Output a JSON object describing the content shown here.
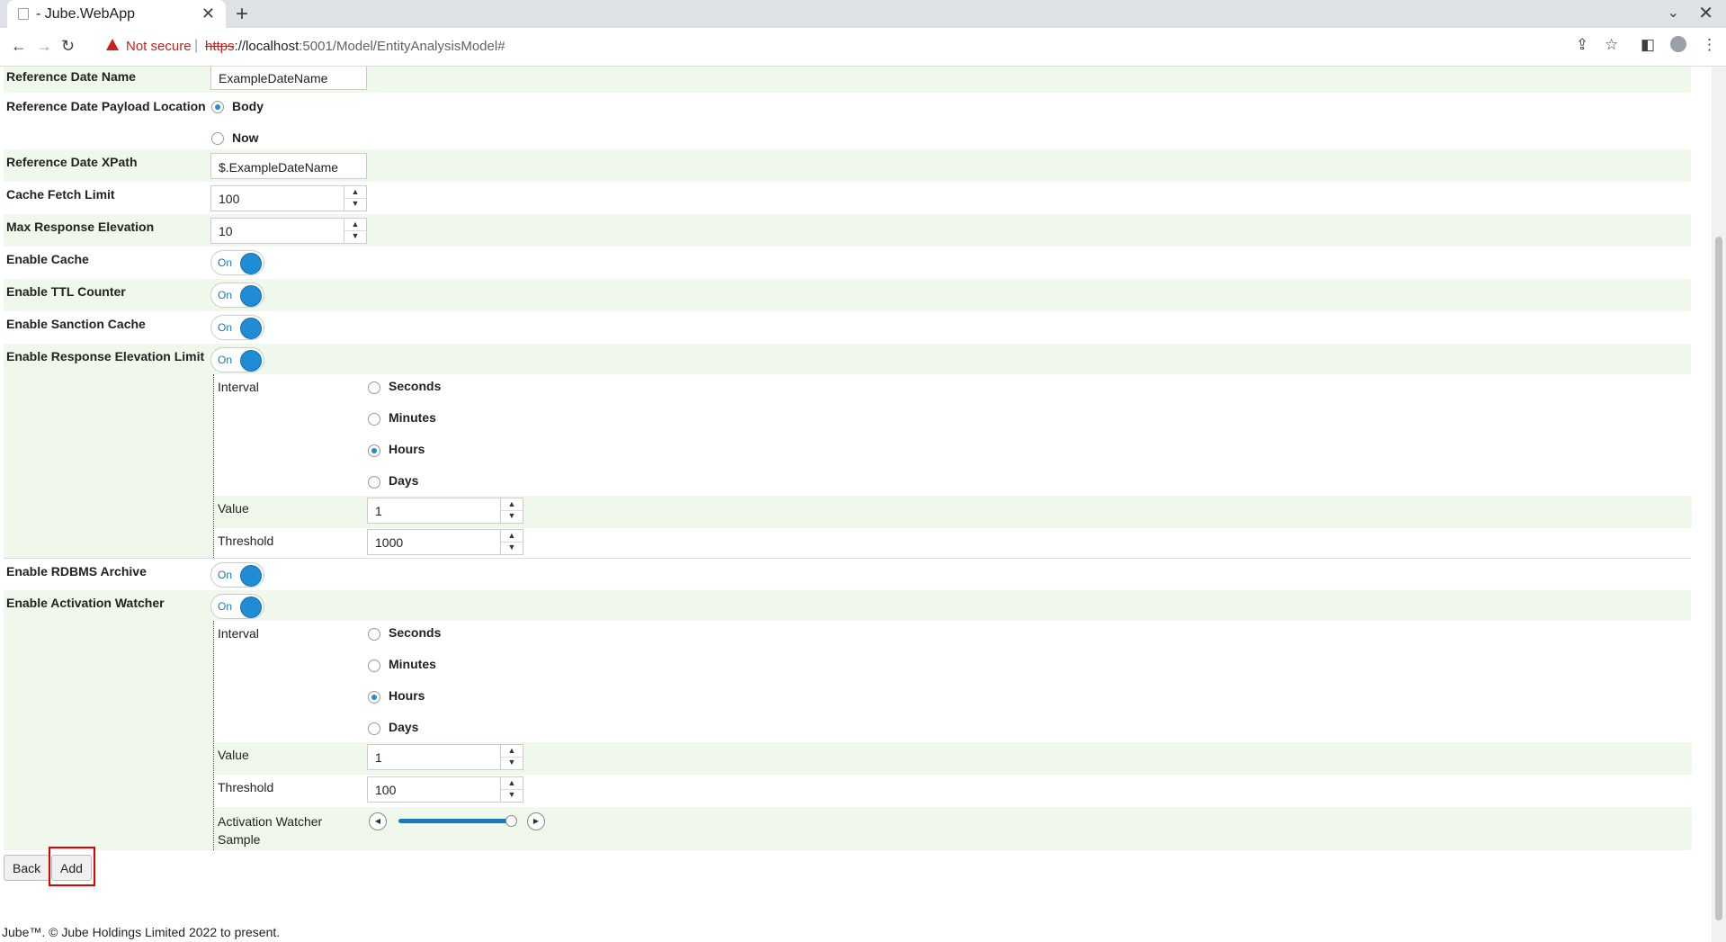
{
  "browser": {
    "tab_title": "- Jube.WebApp",
    "not_secure": "Not secure",
    "url_protocol": "https",
    "url_host": "://localhost",
    "url_rest": ":5001/Model/EntityAnalysisModel#"
  },
  "form": {
    "reference_date_name": {
      "label": "Reference Date Name",
      "value": "ExampleDateName"
    },
    "reference_date_payload_location": {
      "label": "Reference Date Payload Location",
      "options": [
        "Body",
        "Now"
      ],
      "selected": "Body"
    },
    "reference_date_xpath": {
      "label": "Reference Date XPath",
      "value": "$.ExampleDateName"
    },
    "cache_fetch_limit": {
      "label": "Cache Fetch Limit",
      "value": "100"
    },
    "max_response_elevation": {
      "label": "Max Response Elevation",
      "value": "10"
    },
    "enable_cache": {
      "label": "Enable Cache",
      "state": "On"
    },
    "enable_ttl_counter": {
      "label": "Enable TTL Counter",
      "state": "On"
    },
    "enable_sanction_cache": {
      "label": "Enable Sanction Cache",
      "state": "On"
    },
    "enable_response_elevation_limit": {
      "label": "Enable Response Elevation Limit",
      "state": "On",
      "interval_label": "Interval",
      "interval_options": [
        "Seconds",
        "Minutes",
        "Hours",
        "Days"
      ],
      "interval_selected": "Hours",
      "value_label": "Value",
      "value": "1",
      "threshold_label": "Threshold",
      "threshold": "1000"
    },
    "enable_rdbms_archive": {
      "label": "Enable RDBMS Archive",
      "state": "On"
    },
    "enable_activation_watcher": {
      "label": "Enable Activation Watcher",
      "state": "On",
      "interval_label": "Interval",
      "interval_options": [
        "Seconds",
        "Minutes",
        "Hours",
        "Days"
      ],
      "interval_selected": "Hours",
      "value_label": "Value",
      "value": "1",
      "threshold_label": "Threshold",
      "threshold": "100",
      "sample_label_line1": "Activation Watcher",
      "sample_label_line2": "Sample",
      "sample_fraction": 0.97
    }
  },
  "buttons": {
    "back": "Back",
    "add": "Add"
  },
  "footer": "Jube™. © Jube Holdings Limited 2022 to present.",
  "colors": {
    "accent": "#1f8dd6",
    "alt_row": "#eff8ea",
    "highlight": "#e00000"
  }
}
